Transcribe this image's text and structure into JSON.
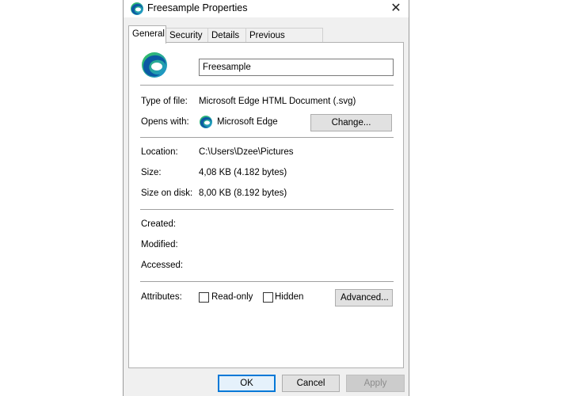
{
  "window": {
    "title": "Freesample Properties",
    "close_glyph": "✕",
    "app_icon": "edge-icon"
  },
  "tabs": [
    {
      "label": "General",
      "active": true
    },
    {
      "label": "Security",
      "active": false
    },
    {
      "label": "Details",
      "active": false
    },
    {
      "label": "Previous Versions",
      "active": false
    }
  ],
  "general": {
    "file_name": "Freesample",
    "type_label": "Type of file:",
    "type_value": "Microsoft Edge HTML Document (.svg)",
    "opens_label": "Opens with:",
    "opens_value": "Microsoft Edge",
    "change_button": "Change...",
    "location_label": "Location:",
    "location_value": "C:\\Users\\Dzee\\Pictures",
    "size_label": "Size:",
    "size_value": "4,08 KB (4.182 bytes)",
    "disk_label": "Size on disk:",
    "disk_value": "8,00 KB (8.192 bytes)",
    "created_label": "Created:",
    "modified_label": "Modified:",
    "accessed_label": "Accessed:",
    "attributes_label": "Attributes:",
    "readonly_label": "Read-only",
    "readonly_checked": false,
    "hidden_label": "Hidden",
    "hidden_checked": false,
    "advanced_button": "Advanced..."
  },
  "footer": {
    "ok": "OK",
    "cancel": "Cancel",
    "apply": "Apply"
  },
  "colors": {
    "accent": "#0078d7",
    "edge_blue": "#0c59a4",
    "edge_green": "#35c15b"
  }
}
